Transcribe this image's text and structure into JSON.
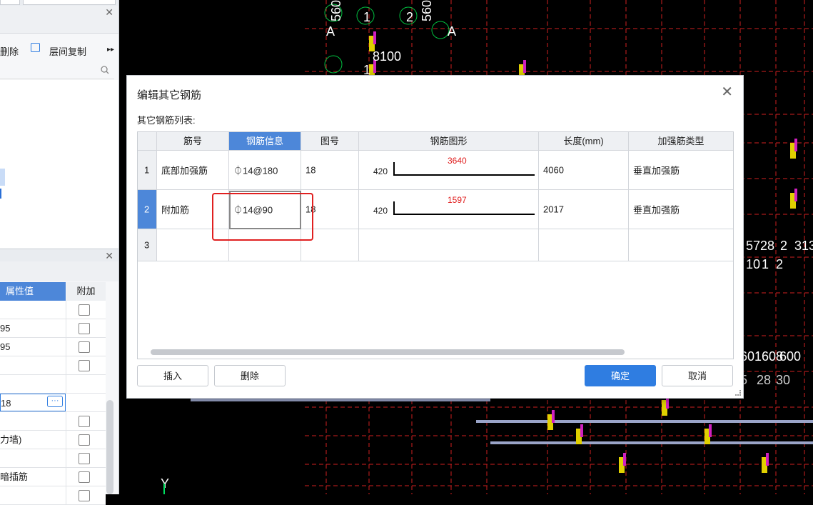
{
  "left_panel": {
    "toolbar": {
      "delete_label": "删除",
      "copy_floor_label": "层间复制",
      "more_icon": "double-chevron-right-icon"
    },
    "search_icon": "search-icon",
    "props": {
      "col_value": "属性值",
      "col_extra": "附加",
      "rows": [
        {
          "value": "",
          "checkbox": true
        },
        {
          "value": "95",
          "checkbox": true
        },
        {
          "value": "95",
          "checkbox": true
        },
        {
          "value": "",
          "checkbox": true
        },
        {
          "value": "",
          "checkbox": false
        },
        {
          "value": "18",
          "checkbox": false,
          "editing": true
        },
        {
          "value": "",
          "checkbox": true
        },
        {
          "value": "力墙)",
          "checkbox": true
        },
        {
          "value": "",
          "checkbox": true
        },
        {
          "value": "暗插筋",
          "checkbox": true
        },
        {
          "value": "",
          "checkbox": true
        }
      ]
    }
  },
  "cad": {
    "labels": [
      "560",
      "560",
      "1",
      "2",
      "A",
      "A",
      "8100",
      "1",
      "5728",
      "2",
      "313",
      "10",
      "1",
      "2",
      "60",
      "1608",
      "600",
      "5",
      "28",
      "30",
      "Y"
    ]
  },
  "dialog": {
    "title": "编辑其它钢筋",
    "subtitle": "其它钢筋列表:",
    "columns": [
      "筋号",
      "钢筋信息",
      "图号",
      "钢筋图形",
      "长度(mm)",
      "加强筋类型"
    ],
    "rows": [
      {
        "num": "1",
        "name": "底部加强筋",
        "info": "⏀14@180",
        "fig": "18",
        "shape_left": "420",
        "shape_top": "3640",
        "length": "4060",
        "type": "垂直加强筋"
      },
      {
        "num": "2",
        "name": "附加筋",
        "info": "⏀14@90",
        "fig": "18",
        "shape_left": "420",
        "shape_top": "1597",
        "length": "2017",
        "type": "垂直加强筋"
      },
      {
        "num": "3",
        "name": "",
        "info": "",
        "fig": "",
        "shape_left": "",
        "shape_top": "",
        "length": "",
        "type": ""
      }
    ],
    "buttons": {
      "insert": "插入",
      "delete": "删除",
      "ok": "确定",
      "cancel": "取消"
    }
  },
  "colors": {
    "accent": "#2f7de1",
    "header_active": "#4d87d9",
    "highlight": "#e02020",
    "cad_bg": "#000000"
  }
}
